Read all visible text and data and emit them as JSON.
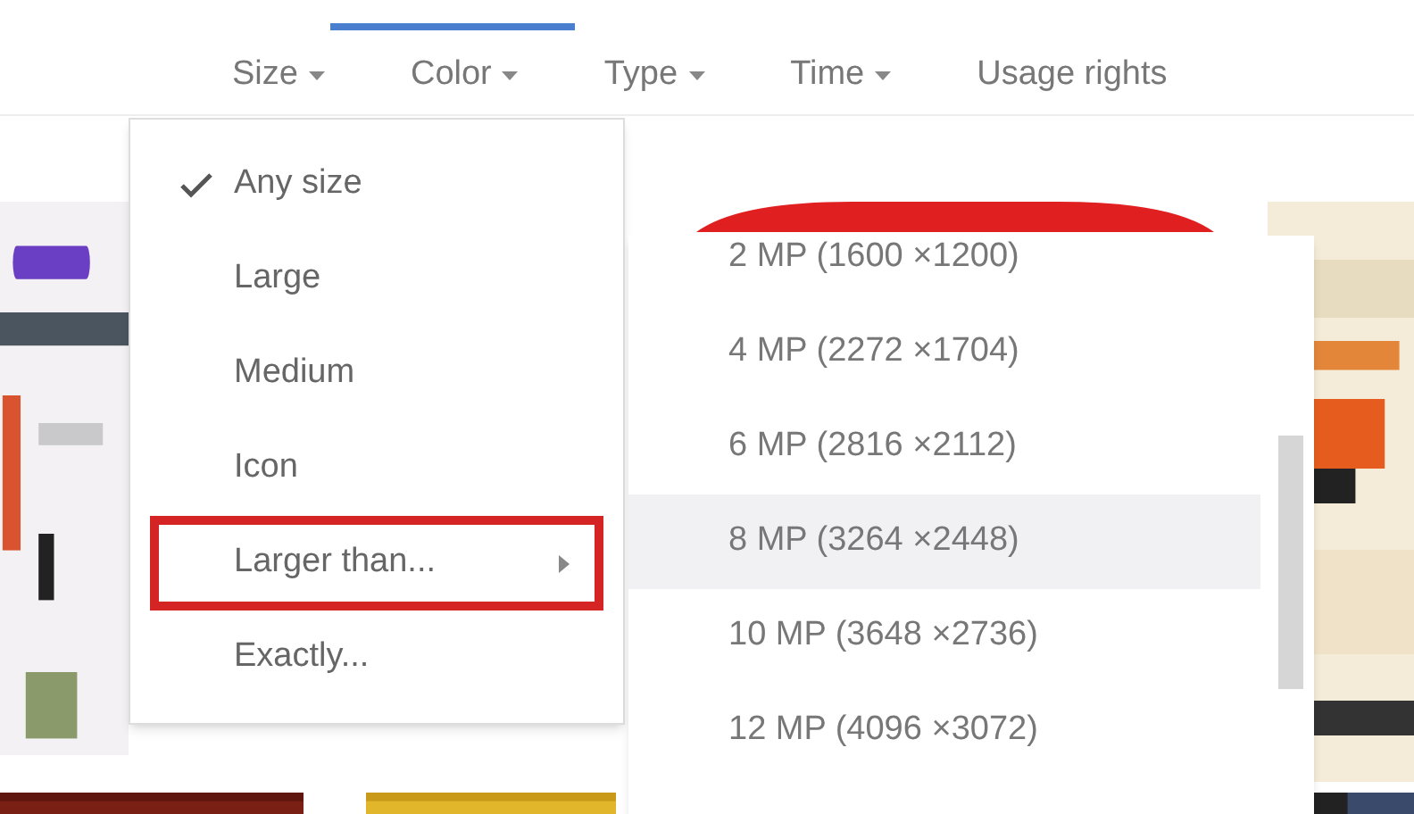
{
  "toolbar": {
    "tabs": [
      {
        "label": "Size",
        "has_dropdown": true
      },
      {
        "label": "Color",
        "has_dropdown": true
      },
      {
        "label": "Type",
        "has_dropdown": true
      },
      {
        "label": "Time",
        "has_dropdown": true
      },
      {
        "label": "Usage rights",
        "has_dropdown": false
      }
    ]
  },
  "size_menu": {
    "items": [
      {
        "label": "Any size",
        "checked": true,
        "outlined": false,
        "has_submenu": false
      },
      {
        "label": "Large",
        "checked": false,
        "outlined": false,
        "has_submenu": false
      },
      {
        "label": "Medium",
        "checked": false,
        "outlined": false,
        "has_submenu": false
      },
      {
        "label": "Icon",
        "checked": false,
        "outlined": false,
        "has_submenu": false
      },
      {
        "label": "Larger than...",
        "checked": false,
        "outlined": true,
        "has_submenu": true
      },
      {
        "label": "Exactly...",
        "checked": false,
        "outlined": false,
        "has_submenu": false
      }
    ]
  },
  "submenu": {
    "items": [
      {
        "label": "2 MP (1600 ×1200)",
        "selected": false
      },
      {
        "label": "4 MP (2272 ×1704)",
        "selected": false
      },
      {
        "label": "6 MP (2816 ×2112)",
        "selected": false
      },
      {
        "label": "8 MP (3264 ×2448)",
        "selected": true
      },
      {
        "label": "10 MP (3648 ×2736)",
        "selected": false
      },
      {
        "label": "12 MP (4096 ×3072)",
        "selected": false
      }
    ]
  }
}
